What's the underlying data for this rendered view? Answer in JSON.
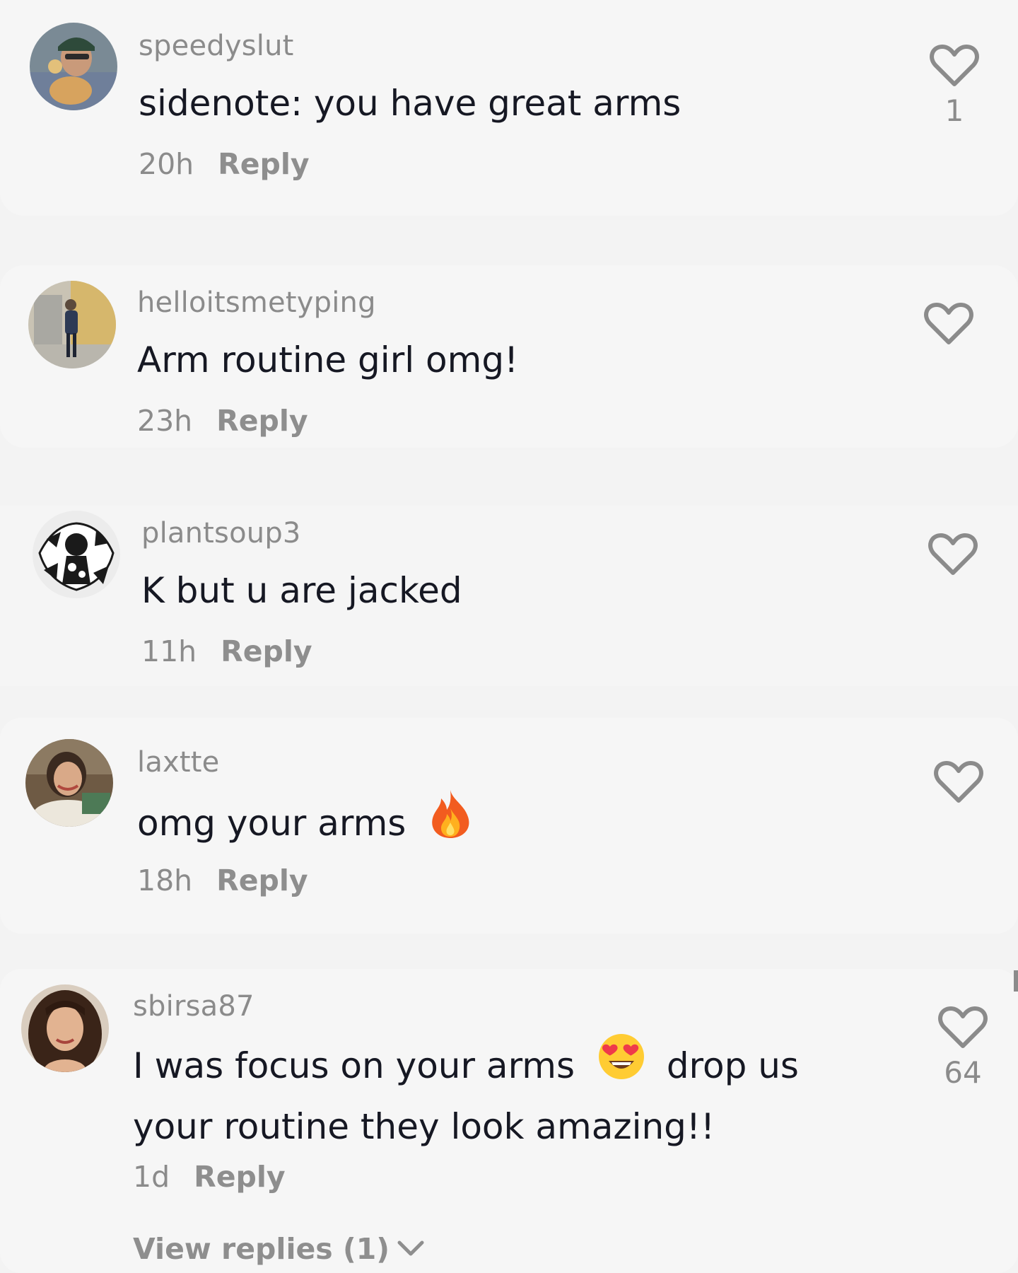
{
  "comments": [
    {
      "username": "speedyslut",
      "text": "sidenote: you have great arms",
      "time": "20h",
      "reply": "Reply",
      "likes": "1",
      "avatar_icon": "avatar-photo"
    },
    {
      "username": "helloitsmetyping",
      "text": "Arm routine girl omg!",
      "time": "23h",
      "reply": "Reply",
      "likes": "",
      "avatar_icon": "avatar-photo"
    },
    {
      "username": "plantsoup3",
      "text": "K but u are jacked",
      "time": "11h",
      "reply": "Reply",
      "likes": "",
      "avatar_icon": "avatar-drawing"
    },
    {
      "username": "laxtte",
      "text": "omg your arms",
      "emoji": "fire-emoji",
      "time": "18h",
      "reply": "Reply",
      "likes": "",
      "avatar_icon": "avatar-photo"
    },
    {
      "username": "sbirsa87",
      "text_part1": "I was focus on your arms",
      "emoji": "heart-eyes-emoji",
      "text_part2": "drop us",
      "text_line2": "your routine they look amazing!!",
      "time": "1d",
      "reply": "Reply",
      "likes": "64",
      "view_replies": "View replies (1)",
      "avatar_icon": "avatar-photo"
    }
  ],
  "colors": {
    "background": "#f3f3f3",
    "text_primary": "#161823",
    "text_secondary": "#8b8b8b"
  }
}
